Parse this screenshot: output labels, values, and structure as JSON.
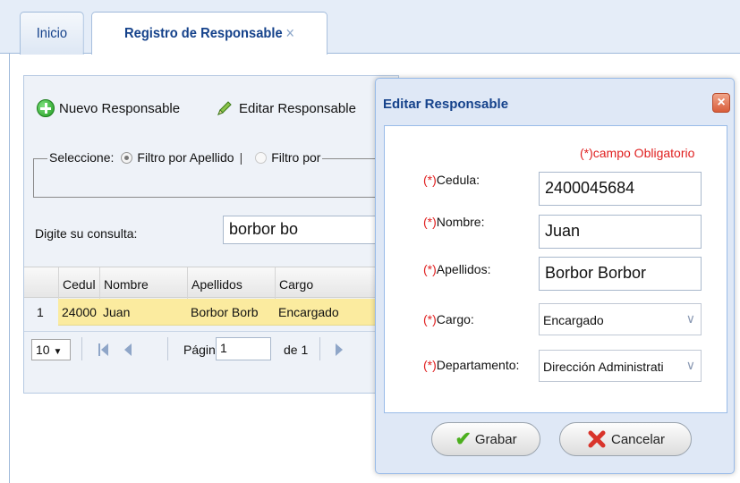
{
  "tabs": [
    {
      "label": "Inicio"
    },
    {
      "label": "Registro de Responsable",
      "close": "×"
    }
  ],
  "toolbar": {
    "new_label": "Nuevo Responsable",
    "edit_label": "Editar Responsable"
  },
  "filter": {
    "legend": "Seleccione:",
    "option1": "Filtro por Apellido",
    "separator": "|",
    "option2": "Filtro por"
  },
  "query": {
    "label": "Digite su consulta:",
    "value": "borbor bo"
  },
  "grid": {
    "columns": [
      "Cedul",
      "Nombre",
      "Apellidos",
      "Cargo"
    ],
    "rows": [
      {
        "num": "1",
        "cedula": "24000",
        "nombre": "Juan",
        "apellidos": "Borbor Borb",
        "cargo": "Encargado"
      }
    ]
  },
  "pager": {
    "page_size": "10",
    "page_label": "Página",
    "page_value": "1",
    "of_label": "de 1"
  },
  "dialog": {
    "title": "Editar Responsable",
    "close": "×",
    "required_note": "(*)campo Obligatorio",
    "fields": {
      "cedula": {
        "asterisk": "(*)",
        "label": "Cedula:",
        "value": "2400045684"
      },
      "nombre": {
        "asterisk": "(*)",
        "label": "Nombre:",
        "value": "Juan"
      },
      "apellidos": {
        "asterisk": "(*)",
        "label": "Apellidos:",
        "value": "Borbor Borbor"
      },
      "cargo": {
        "asterisk": "(*)",
        "label": "Cargo:",
        "value": "Encargado"
      },
      "departamento": {
        "asterisk": "(*)",
        "label": "Departamento:",
        "value": "Dirección Administrati"
      }
    },
    "save_label": "Grabar",
    "cancel_label": "Cancelar"
  },
  "colors": {
    "accent": "#15428b",
    "required": "#e02020",
    "selected_row": "#fbeb9f"
  }
}
